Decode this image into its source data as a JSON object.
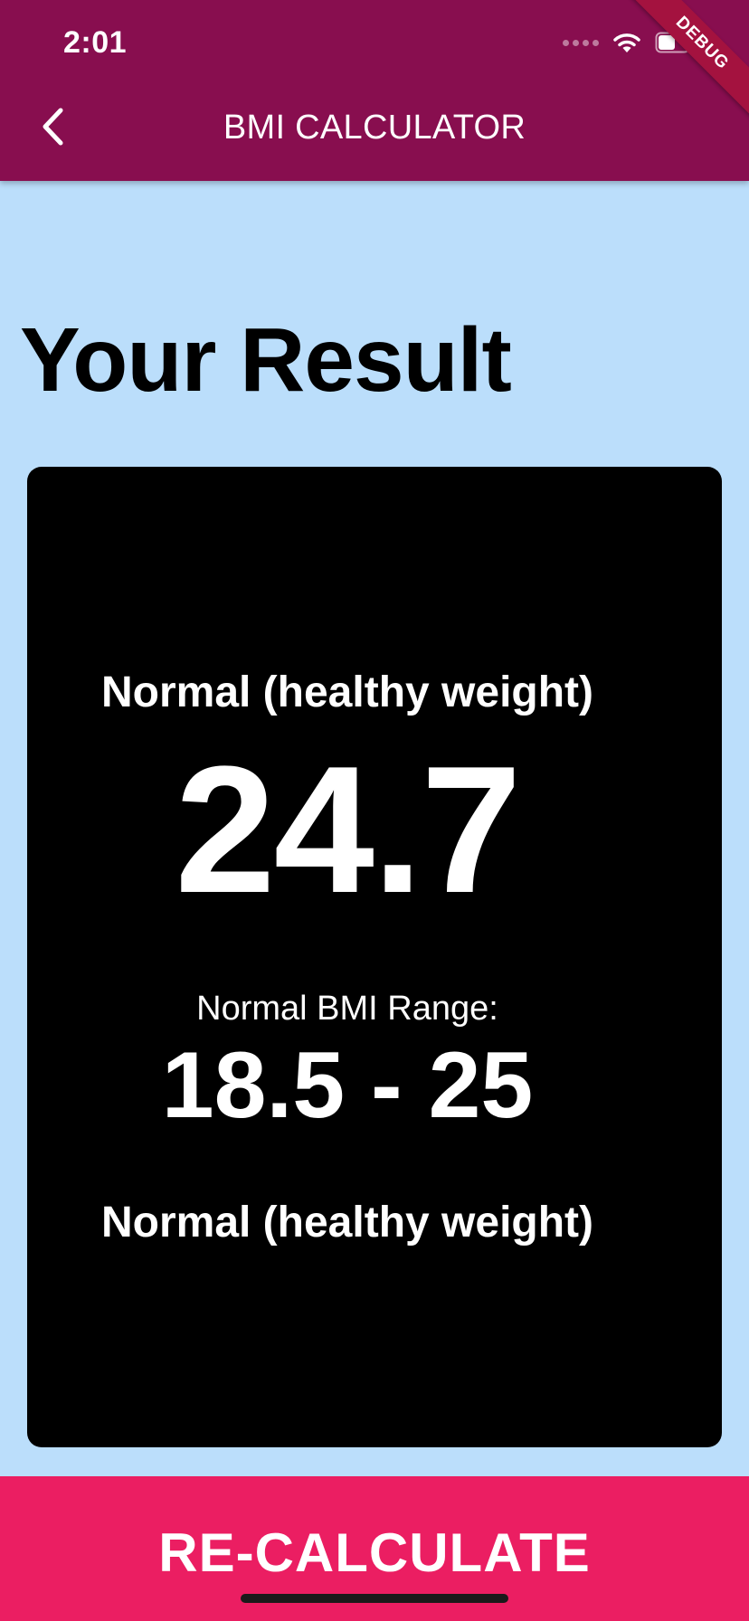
{
  "status_bar": {
    "time": "2:01",
    "icons": [
      "signal-icon",
      "wifi-icon",
      "battery-icon"
    ]
  },
  "app_bar": {
    "title": "BMI CALCULATOR",
    "back_icon": "chevron-left-icon",
    "background_color": "#880e4f"
  },
  "debug_banner": {
    "label": "DEBUG"
  },
  "page": {
    "heading": "Your Result",
    "background_color": "#bbdefb"
  },
  "result_card": {
    "status_top": "Normal (healthy weight)",
    "bmi_value": "24.7",
    "range_label": "Normal BMI Range:",
    "range_value": "18.5 - 25",
    "status_bottom": "Normal (healthy weight)",
    "background_color": "#000000"
  },
  "actions": {
    "recalculate_label": "RE-CALCULATE",
    "recalculate_color": "#eb1e62"
  }
}
